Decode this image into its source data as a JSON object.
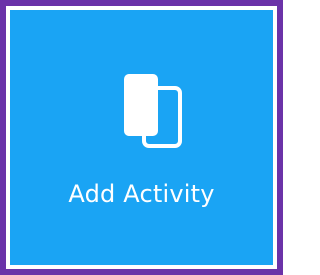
{
  "tile": {
    "label": "Add Activity",
    "icon": "duplicate-cards-icon",
    "colors": {
      "frame": "#6b32a8",
      "background": "#1aa4f4",
      "foreground": "#ffffff"
    }
  }
}
